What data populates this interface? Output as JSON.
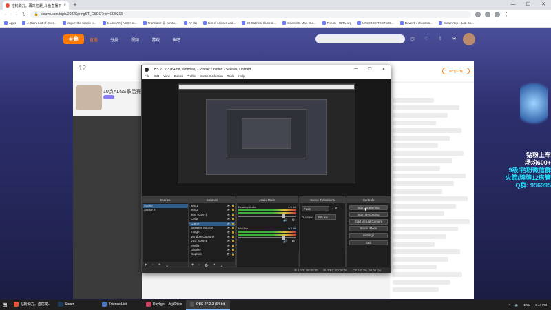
{
  "browser": {
    "tab_title": "帕帕助力，再来狂潮_斗鱼直播平台",
    "address": "douyu.com/topic/2022SpringST_CSGO?rid=5820215",
    "bookmarks": [
      "Apps",
      "A Giant List of Over...",
      "imgur: the simple o...",
      "1 Line Art | ASCII ar...",
      "Translator @ ezmto...",
      "AT (1)",
      "List of Animes and...",
      "20 Satirical Illustrati...",
      "Scientists Map Out...",
      "Forum - HLTV.org",
      "UNICODE TEST v88...",
      "Dave2k / cheaters...",
      "SteamRep » LoL Bo..."
    ]
  },
  "douyu": {
    "logo": "斗鱼",
    "nav": [
      "首页",
      "直播",
      "分类",
      "视频",
      "游戏",
      "鱼吧"
    ],
    "stat_count": "12",
    "streamer_title": "10点ALGS季后赛",
    "pc_button": "PC客户端",
    "promo": [
      "钻粉上车",
      "场均600+",
      "9级/钻粉微信群",
      "火箭/牌牌12房管",
      "Q群: 956995"
    ]
  },
  "obs": {
    "title": "OBS 27.2.3 (64-bit, windows) - Profile: Untitled - Scenes: Untitled",
    "menu": [
      "File",
      "Edit",
      "View",
      "Docks",
      "Profile",
      "Scene Collection",
      "Tools",
      "Help"
    ],
    "no_source": "No source selected",
    "properties": "Properties",
    "filters": "Filters",
    "docks": {
      "scenes": {
        "title": "Scenes",
        "items": [
          "Scene",
          "Scene 2"
        ]
      },
      "sources": {
        "title": "Sources",
        "items": [
          "Text1",
          "Text2",
          "Text (GDI+)",
          "Color",
          "Game",
          "Browser Source",
          "Image",
          "Window Capture",
          "VLC Source",
          "Media",
          "Display",
          "Capture"
        ]
      },
      "mixer": {
        "title": "Audio Mixer",
        "channels": [
          {
            "name": "Desktop Audio",
            "db": "0.0 dB"
          },
          {
            "name": "Mic/Aux",
            "db": "0.0 dB"
          }
        ]
      },
      "transitions": {
        "title": "Scene Transitions",
        "type": "Fade",
        "duration_label": "Duration",
        "duration": "300 ms"
      },
      "controls": {
        "title": "Controls",
        "buttons": [
          "Start Streaming",
          "Start Recording",
          "Start Virtual Camera",
          "Studio Mode",
          "Settings",
          "Exit"
        ]
      }
    },
    "status": {
      "live": "LIVE: 00:00:00",
      "rec": "REC: 00:00:00",
      "cpu": "CPU: 0.7%, 30.00 fps"
    }
  },
  "taskbar": {
    "items": [
      {
        "label": "钻粉助力，盗窃觉...",
        "color": "#e8533b"
      },
      {
        "label": "Steam",
        "color": "#1b3a5c"
      },
      {
        "label": "Friends List",
        "color": "#4a78c8"
      },
      {
        "label": "Daylight - Joji/Diplo",
        "color": "#d04060"
      },
      {
        "label": "OBS 27.2.3 (64-bit, wi...",
        "color": "#555"
      }
    ],
    "lang": "ENG",
    "time": "9:14 PM"
  }
}
